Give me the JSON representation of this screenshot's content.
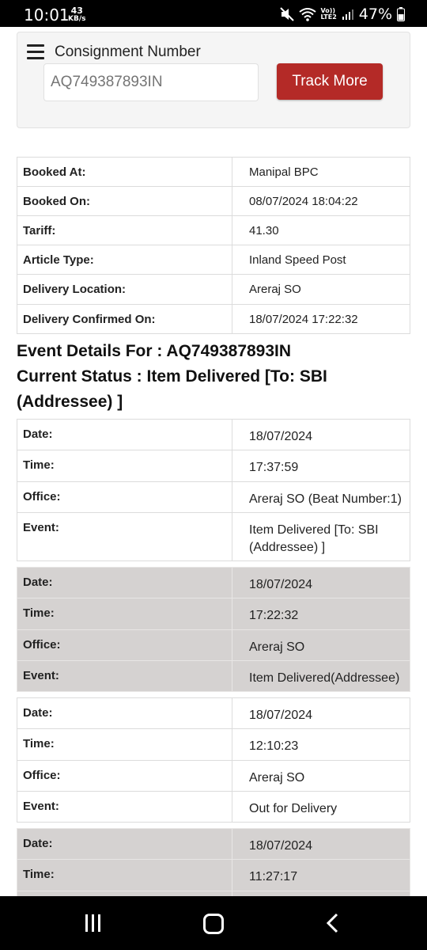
{
  "status_bar": {
    "time": "10:01",
    "speed_value": "43",
    "speed_unit": "KB/s",
    "volte_line1": "Vo))",
    "volte_line2": "LTE2",
    "battery": "47%"
  },
  "search": {
    "menu_icon": "hamburger-menu-icon",
    "label": "Consignment Number",
    "placeholder": "AQ749387893IN",
    "button_label": "Track More",
    "button_color": "#b42a27"
  },
  "booking_details": [
    {
      "label": "Booked At:",
      "value": "Manipal BPC"
    },
    {
      "label": "Booked On:",
      "value": "08/07/2024 18:04:22"
    },
    {
      "label": "Tariff:",
      "value": "41.30"
    },
    {
      "label": "Article Type:",
      "value": "Inland Speed Post"
    },
    {
      "label": "Delivery Location:",
      "value": "Areraj SO"
    },
    {
      "label": "Delivery Confirmed On:",
      "value": "18/07/2024 17:22:32"
    }
  ],
  "event_details": {
    "heading": "Event Details For : AQ749387893IN",
    "status_line1": "Current Status : Item Delivered [To: SBI",
    "status_line2": "(Addressee) ]",
    "labels": {
      "date": "Date:",
      "time": "Time:",
      "office": "Office:",
      "event": "Event:"
    },
    "events": [
      {
        "date": "18/07/2024",
        "time": "17:37:59",
        "office": "Areraj SO (Beat Number:1)",
        "event_line1": "Item Delivered [To: SBI",
        "event_line2": "(Addressee) ]"
      },
      {
        "date": "18/07/2024",
        "time": "17:22:32",
        "office": "Areraj SO",
        "event": "Item Delivered(Addressee)"
      },
      {
        "date": "18/07/2024",
        "time": "12:10:23",
        "office": "Areraj SO",
        "event": "Out for Delivery"
      },
      {
        "date": "18/07/2024",
        "time": "11:27:17"
      }
    ]
  },
  "colors": {
    "shaded_row": "#d5d2d1",
    "accent": "#b42a27"
  },
  "nav_bar": {
    "recents_icon": "recents-icon",
    "home_icon": "home-icon",
    "back_icon": "back-chevron-icon"
  }
}
